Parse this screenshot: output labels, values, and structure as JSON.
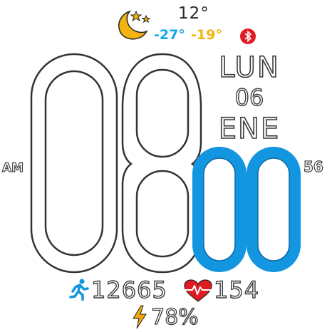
{
  "weather": {
    "icon": "moon-stars-icon",
    "temperature": "12°",
    "min": "-27°",
    "max": "-19°",
    "min_color": "#13a9e8",
    "max_color": "#f3b410"
  },
  "status": {
    "bluetooth_icon": "bluetooth-icon",
    "bluetooth_color": "#e01b22"
  },
  "date": {
    "weekday": "LUN",
    "day": "06",
    "month": "ENE"
  },
  "time": {
    "hours": "08",
    "minutes": "00",
    "seconds": "56",
    "ampm": "AM",
    "minutes_color": "#1396e0"
  },
  "stats": {
    "steps": "12665",
    "heart_rate": "154",
    "battery": "78%",
    "steps_color": "#1396e0",
    "heart_color": "#e01b22",
    "battery_color": "#f3a510"
  }
}
